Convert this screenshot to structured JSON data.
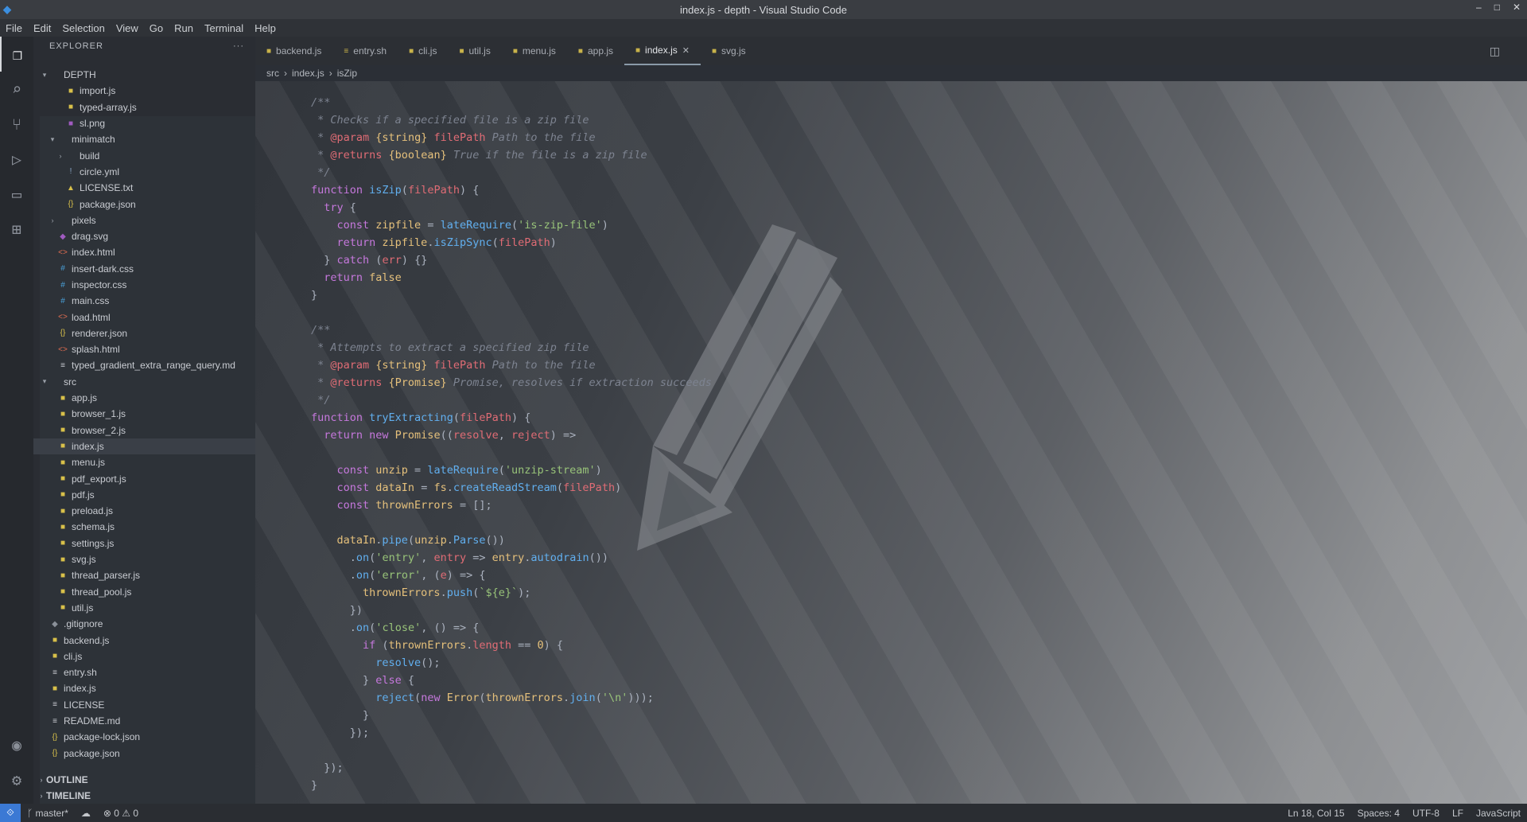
{
  "window": {
    "title": "index.js - depth - Visual Studio Code",
    "minimize": "–",
    "maximize": "□",
    "close": "✕"
  },
  "menu": [
    "File",
    "Edit",
    "Selection",
    "View",
    "Go",
    "Run",
    "Terminal",
    "Help"
  ],
  "activity": [
    {
      "name": "files-icon",
      "glyph": "❐"
    },
    {
      "name": "search-icon",
      "glyph": "⌕"
    },
    {
      "name": "source-control-icon",
      "glyph": "⑂"
    },
    {
      "name": "run-debug-icon",
      "glyph": "▷"
    },
    {
      "name": "remote-explorer-icon",
      "glyph": "▭"
    },
    {
      "name": "extensions-icon",
      "glyph": "⊞"
    }
  ],
  "activity_bottom": [
    {
      "name": "account-icon",
      "glyph": "◉"
    },
    {
      "name": "settings-gear-icon",
      "glyph": "⚙"
    }
  ],
  "sidebar": {
    "header": "EXPLORER",
    "more": "···",
    "items": [
      {
        "indent": 0,
        "twisty": "▾",
        "icon": "",
        "color": "#c9ccd2",
        "label": "DEPTH"
      },
      {
        "indent": 2,
        "twisty": "",
        "icon": "■",
        "color": "#d8c04a",
        "label": "import.js"
      },
      {
        "indent": 2,
        "twisty": "",
        "icon": "■",
        "color": "#d8c04a",
        "label": "typed-array.js"
      },
      {
        "indent": 2,
        "twisty": "",
        "icon": "■",
        "color": "#a05bc0",
        "label": "sl.png"
      },
      {
        "indent": 1,
        "twisty": "▾",
        "icon": "",
        "color": "#c9ccd2",
        "label": "minimatch"
      },
      {
        "indent": 2,
        "twisty": "›",
        "icon": "",
        "color": "#c9ccd2",
        "label": "build"
      },
      {
        "indent": 2,
        "twisty": "",
        "icon": "!",
        "color": "#8aa7c8",
        "label": "circle.yml"
      },
      {
        "indent": 2,
        "twisty": "",
        "icon": "▲",
        "color": "#d8c04a",
        "label": "LICENSE.txt"
      },
      {
        "indent": 2,
        "twisty": "",
        "icon": "{}",
        "color": "#d8c04a",
        "label": "package.json"
      },
      {
        "indent": 1,
        "twisty": "›",
        "icon": "",
        "color": "#c9ccd2",
        "label": "pixels"
      },
      {
        "indent": 1,
        "twisty": "",
        "icon": "◆",
        "color": "#a05bc0",
        "label": "drag.svg"
      },
      {
        "indent": 1,
        "twisty": "",
        "icon": "<>",
        "color": "#e06c50",
        "label": "index.html"
      },
      {
        "indent": 1,
        "twisty": "",
        "icon": "#",
        "color": "#4aa0d8",
        "label": "insert-dark.css"
      },
      {
        "indent": 1,
        "twisty": "",
        "icon": "#",
        "color": "#4aa0d8",
        "label": "inspector.css"
      },
      {
        "indent": 1,
        "twisty": "",
        "icon": "#",
        "color": "#4aa0d8",
        "label": "main.css"
      },
      {
        "indent": 1,
        "twisty": "",
        "icon": "<>",
        "color": "#e06c50",
        "label": "load.html"
      },
      {
        "indent": 1,
        "twisty": "",
        "icon": "{}",
        "color": "#d8c04a",
        "label": "renderer.json"
      },
      {
        "indent": 1,
        "twisty": "",
        "icon": "<>",
        "color": "#e06c50",
        "label": "splash.html"
      },
      {
        "indent": 1,
        "twisty": "",
        "icon": "≡",
        "color": "#c9ccd2",
        "label": "typed_gradient_extra_range_query.md"
      },
      {
        "indent": 0,
        "twisty": "▾",
        "icon": "",
        "color": "#c9ccd2",
        "label": "src"
      },
      {
        "indent": 1,
        "twisty": "",
        "icon": "■",
        "color": "#d8c04a",
        "label": "app.js"
      },
      {
        "indent": 1,
        "twisty": "",
        "icon": "■",
        "color": "#d8c04a",
        "label": "browser_1.js"
      },
      {
        "indent": 1,
        "twisty": "",
        "icon": "■",
        "color": "#d8c04a",
        "label": "browser_2.js"
      },
      {
        "indent": 1,
        "twisty": "",
        "icon": "■",
        "color": "#d8c04a",
        "label": "index.js",
        "selected": true
      },
      {
        "indent": 1,
        "twisty": "",
        "icon": "■",
        "color": "#d8c04a",
        "label": "menu.js"
      },
      {
        "indent": 1,
        "twisty": "",
        "icon": "■",
        "color": "#d8c04a",
        "label": "pdf_export.js"
      },
      {
        "indent": 1,
        "twisty": "",
        "icon": "■",
        "color": "#d8c04a",
        "label": "pdf.js"
      },
      {
        "indent": 1,
        "twisty": "",
        "icon": "■",
        "color": "#d8c04a",
        "label": "preload.js"
      },
      {
        "indent": 1,
        "twisty": "",
        "icon": "■",
        "color": "#d8c04a",
        "label": "schema.js"
      },
      {
        "indent": 1,
        "twisty": "",
        "icon": "■",
        "color": "#d8c04a",
        "label": "settings.js"
      },
      {
        "indent": 1,
        "twisty": "",
        "icon": "■",
        "color": "#d8c04a",
        "label": "svg.js"
      },
      {
        "indent": 1,
        "twisty": "",
        "icon": "■",
        "color": "#d8c04a",
        "label": "thread_parser.js"
      },
      {
        "indent": 1,
        "twisty": "",
        "icon": "■",
        "color": "#d8c04a",
        "label": "thread_pool.js"
      },
      {
        "indent": 1,
        "twisty": "",
        "icon": "■",
        "color": "#d8c04a",
        "label": "util.js"
      },
      {
        "indent": 0,
        "twisty": "",
        "icon": "◆",
        "color": "#8a9099",
        "label": ".gitignore"
      },
      {
        "indent": 0,
        "twisty": "",
        "icon": "■",
        "color": "#d8c04a",
        "label": "backend.js"
      },
      {
        "indent": 0,
        "twisty": "",
        "icon": "■",
        "color": "#d8c04a",
        "label": "cli.js"
      },
      {
        "indent": 0,
        "twisty": "",
        "icon": "≡",
        "color": "#c9ccd2",
        "label": "entry.sh"
      },
      {
        "indent": 0,
        "twisty": "",
        "icon": "■",
        "color": "#d8c04a",
        "label": "index.js"
      },
      {
        "indent": 0,
        "twisty": "",
        "icon": "≡",
        "color": "#c9ccd2",
        "label": "LICENSE"
      },
      {
        "indent": 0,
        "twisty": "",
        "icon": "≡",
        "color": "#c9ccd2",
        "label": "README.md"
      },
      {
        "indent": 0,
        "twisty": "",
        "icon": "{}",
        "color": "#d8c04a",
        "label": "package-lock.json"
      },
      {
        "indent": 0,
        "twisty": "",
        "icon": "{}",
        "color": "#d8c04a",
        "label": "package.json"
      }
    ],
    "footer": [
      {
        "twisty": "›",
        "label": "OUTLINE"
      },
      {
        "twisty": "›",
        "label": "TIMELINE"
      }
    ]
  },
  "tabs": [
    {
      "label": "backend.js",
      "icon": "■",
      "active": false
    },
    {
      "label": "entry.sh",
      "icon": "≡",
      "active": false
    },
    {
      "label": "cli.js",
      "icon": "■",
      "active": false
    },
    {
      "label": "util.js",
      "icon": "■",
      "active": false
    },
    {
      "label": "menu.js",
      "icon": "■",
      "active": false
    },
    {
      "label": "app.js",
      "icon": "■",
      "active": false
    },
    {
      "label": "index.js",
      "icon": "■",
      "active": true
    },
    {
      "label": "svg.js",
      "icon": "■",
      "active": false
    }
  ],
  "tab_close": "✕",
  "split_icon": "◫",
  "breadcrumbs": [
    "src",
    "›",
    "index.js",
    "›",
    "isZip"
  ],
  "code_lines": [
    [
      [
        "c-com",
        "/**"
      ]
    ],
    [
      [
        "c-com",
        " * Checks if a specified file is a zip file"
      ]
    ],
    [
      [
        "c-com",
        " * "
      ],
      [
        "c-prm",
        "@param"
      ],
      [
        "c-var",
        " {string}"
      ],
      [
        "c-prm",
        " filePath"
      ],
      [
        "c-com",
        " Path to the file"
      ]
    ],
    [
      [
        "c-com",
        " * "
      ],
      [
        "c-prm",
        "@returns"
      ],
      [
        "c-var",
        " {boolean}"
      ],
      [
        "c-com",
        " True if the file is a zip file"
      ]
    ],
    [
      [
        "c-com",
        " */"
      ]
    ],
    [
      [
        "c-kw",
        "function "
      ],
      [
        "c-fn",
        "isZip"
      ],
      [
        "c-txt",
        "("
      ],
      [
        "c-prm",
        "filePath"
      ],
      [
        "c-txt",
        ") {"
      ]
    ],
    [
      [
        "c-kw",
        "  try "
      ],
      [
        "c-txt",
        "{"
      ]
    ],
    [
      [
        "c-kw",
        "    const "
      ],
      [
        "c-var",
        "zipfile"
      ],
      [
        "c-txt",
        " = "
      ],
      [
        "c-fn",
        "lateRequire"
      ],
      [
        "c-txt",
        "("
      ],
      [
        "c-str",
        "'is-zip-file'"
      ],
      [
        "c-txt",
        ")"
      ]
    ],
    [
      [
        "c-kw",
        "    return "
      ],
      [
        "c-var",
        "zipfile"
      ],
      [
        "c-txt",
        "."
      ],
      [
        "c-fn",
        "isZipSync"
      ],
      [
        "c-txt",
        "("
      ],
      [
        "c-prm",
        "filePath"
      ],
      [
        "c-txt",
        ")"
      ]
    ],
    [
      [
        "c-txt",
        "  } "
      ],
      [
        "c-kw",
        "catch "
      ],
      [
        "c-txt",
        "("
      ],
      [
        "c-prm",
        "err"
      ],
      [
        "c-txt",
        ") {}"
      ]
    ],
    [
      [
        "c-kw",
        "  return "
      ],
      [
        "c-var",
        "false"
      ]
    ],
    [
      [
        "c-txt",
        "}"
      ]
    ],
    [
      [
        "c-txt",
        ""
      ]
    ],
    [
      [
        "c-com",
        "/**"
      ]
    ],
    [
      [
        "c-com",
        " * Attempts to extract a specified zip file"
      ]
    ],
    [
      [
        "c-com",
        " * "
      ],
      [
        "c-prm",
        "@param"
      ],
      [
        "c-var",
        " {string}"
      ],
      [
        "c-prm",
        " filePath"
      ],
      [
        "c-com",
        " Path to the file"
      ]
    ],
    [
      [
        "c-com",
        " * "
      ],
      [
        "c-prm",
        "@returns"
      ],
      [
        "c-var",
        " {Promise}"
      ],
      [
        "c-com",
        " Promise, resolves if extraction succeeds"
      ]
    ],
    [
      [
        "c-com",
        " */"
      ]
    ],
    [
      [
        "c-kw",
        "function "
      ],
      [
        "c-fn",
        "tryExtracting"
      ],
      [
        "c-txt",
        "("
      ],
      [
        "c-prm",
        "filePath"
      ],
      [
        "c-txt",
        ") {"
      ]
    ],
    [
      [
        "c-kw",
        "  return new "
      ],
      [
        "c-var",
        "Promise"
      ],
      [
        "c-txt",
        "(("
      ],
      [
        "c-prm",
        "resolve"
      ],
      [
        "c-txt",
        ", "
      ],
      [
        "c-prm",
        "reject"
      ],
      [
        "c-txt",
        ") =>"
      ]
    ],
    [
      [
        "c-txt",
        ""
      ]
    ],
    [
      [
        "c-kw",
        "    const "
      ],
      [
        "c-var",
        "unzip"
      ],
      [
        "c-txt",
        " = "
      ],
      [
        "c-fn",
        "lateRequire"
      ],
      [
        "c-txt",
        "("
      ],
      [
        "c-str",
        "'unzip-stream'"
      ],
      [
        "c-txt",
        ")"
      ]
    ],
    [
      [
        "c-kw",
        "    const "
      ],
      [
        "c-var",
        "dataIn"
      ],
      [
        "c-txt",
        " = "
      ],
      [
        "c-var",
        "fs"
      ],
      [
        "c-txt",
        "."
      ],
      [
        "c-fn",
        "createReadStream"
      ],
      [
        "c-txt",
        "("
      ],
      [
        "c-prm",
        "filePath"
      ],
      [
        "c-txt",
        ")"
      ]
    ],
    [
      [
        "c-kw",
        "    const "
      ],
      [
        "c-var",
        "thrownErrors"
      ],
      [
        "c-txt",
        " = [];"
      ]
    ],
    [
      [
        "c-txt",
        ""
      ]
    ],
    [
      [
        "c-var",
        "    dataIn"
      ],
      [
        "c-txt",
        "."
      ],
      [
        "c-fn",
        "pipe"
      ],
      [
        "c-txt",
        "("
      ],
      [
        "c-var",
        "unzip"
      ],
      [
        "c-txt",
        "."
      ],
      [
        "c-fn",
        "Parse"
      ],
      [
        "c-txt",
        "())"
      ]
    ],
    [
      [
        "c-txt",
        "      ."
      ],
      [
        "c-fn",
        "on"
      ],
      [
        "c-txt",
        "("
      ],
      [
        "c-str",
        "'entry'"
      ],
      [
        "c-txt",
        ", "
      ],
      [
        "c-prm",
        "entry"
      ],
      [
        "c-txt",
        " => "
      ],
      [
        "c-var",
        "entry"
      ],
      [
        "c-txt",
        "."
      ],
      [
        "c-fn",
        "autodrain"
      ],
      [
        "c-txt",
        "())"
      ]
    ],
    [
      [
        "c-txt",
        "      ."
      ],
      [
        "c-fn",
        "on"
      ],
      [
        "c-txt",
        "("
      ],
      [
        "c-str",
        "'error'"
      ],
      [
        "c-txt",
        ", ("
      ],
      [
        "c-prm",
        "e"
      ],
      [
        "c-txt",
        ") => {"
      ]
    ],
    [
      [
        "c-var",
        "        thrownErrors"
      ],
      [
        "c-txt",
        "."
      ],
      [
        "c-fn",
        "push"
      ],
      [
        "c-txt",
        "("
      ],
      [
        "c-str",
        "`${e}`"
      ],
      [
        "c-txt",
        ");"
      ]
    ],
    [
      [
        "c-txt",
        "      })"
      ]
    ],
    [
      [
        "c-txt",
        "      ."
      ],
      [
        "c-fn",
        "on"
      ],
      [
        "c-txt",
        "("
      ],
      [
        "c-str",
        "'close'"
      ],
      [
        "c-txt",
        ", () => {"
      ]
    ],
    [
      [
        "c-kw",
        "        if "
      ],
      [
        "c-txt",
        "("
      ],
      [
        "c-var",
        "thrownErrors"
      ],
      [
        "c-txt",
        "."
      ],
      [
        "c-prm",
        "length"
      ],
      [
        "c-txt",
        " == "
      ],
      [
        "c-var",
        "0"
      ],
      [
        "c-txt",
        ") {"
      ]
    ],
    [
      [
        "c-fn",
        "          resolve"
      ],
      [
        "c-txt",
        "();"
      ]
    ],
    [
      [
        "c-txt",
        "        } "
      ],
      [
        "c-kw",
        "else "
      ],
      [
        "c-txt",
        "{"
      ]
    ],
    [
      [
        "c-fn",
        "          reject"
      ],
      [
        "c-txt",
        "("
      ],
      [
        "c-kw",
        "new "
      ],
      [
        "c-var",
        "Error"
      ],
      [
        "c-txt",
        "("
      ],
      [
        "c-var",
        "thrownErrors"
      ],
      [
        "c-txt",
        "."
      ],
      [
        "c-fn",
        "join"
      ],
      [
        "c-txt",
        "("
      ],
      [
        "c-str",
        "'\\n'"
      ],
      [
        "c-txt",
        ")));"
      ]
    ],
    [
      [
        "c-txt",
        "        }"
      ]
    ],
    [
      [
        "c-txt",
        "      });"
      ]
    ],
    [
      [
        "c-txt",
        ""
      ]
    ],
    [
      [
        "c-txt",
        "  });"
      ]
    ],
    [
      [
        "c-txt",
        "}"
      ]
    ]
  ],
  "status": {
    "remote": "⟐",
    "branch": "ᚴ master*",
    "sync": "☁",
    "problems": "⊗ 0 ⚠ 0",
    "position": "Ln 18, Col 15",
    "spaces": "Spaces: 4",
    "encoding": "UTF-8",
    "eol": "LF",
    "language": "JavaScript"
  }
}
